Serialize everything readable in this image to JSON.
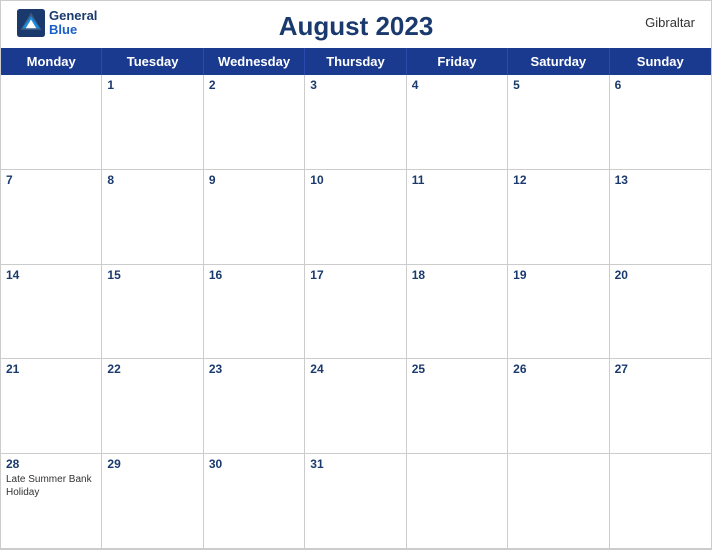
{
  "header": {
    "title": "August 2023",
    "country": "Gibraltar",
    "logo_line1": "General",
    "logo_line2": "Blue"
  },
  "weekdays": [
    "Monday",
    "Tuesday",
    "Wednesday",
    "Thursday",
    "Friday",
    "Saturday",
    "Sunday"
  ],
  "weeks": [
    [
      {
        "num": "",
        "empty": true
      },
      {
        "num": "1"
      },
      {
        "num": "2"
      },
      {
        "num": "3"
      },
      {
        "num": "4"
      },
      {
        "num": "5"
      },
      {
        "num": "6"
      }
    ],
    [
      {
        "num": "7"
      },
      {
        "num": "8"
      },
      {
        "num": "9"
      },
      {
        "num": "10"
      },
      {
        "num": "11"
      },
      {
        "num": "12"
      },
      {
        "num": "13"
      }
    ],
    [
      {
        "num": "14"
      },
      {
        "num": "15"
      },
      {
        "num": "16"
      },
      {
        "num": "17"
      },
      {
        "num": "18"
      },
      {
        "num": "19"
      },
      {
        "num": "20"
      }
    ],
    [
      {
        "num": "21"
      },
      {
        "num": "22"
      },
      {
        "num": "23"
      },
      {
        "num": "24"
      },
      {
        "num": "25"
      },
      {
        "num": "26"
      },
      {
        "num": "27"
      }
    ],
    [
      {
        "num": "28",
        "holiday": "Late Summer Bank Holiday"
      },
      {
        "num": "29"
      },
      {
        "num": "30"
      },
      {
        "num": "31"
      },
      {
        "num": "",
        "empty": true
      },
      {
        "num": "",
        "empty": true
      },
      {
        "num": "",
        "empty": true
      }
    ]
  ],
  "colors": {
    "header_bg": "#1a3a8f",
    "title_color": "#1a3a6e",
    "day_number_color": "#1a3a6e"
  }
}
